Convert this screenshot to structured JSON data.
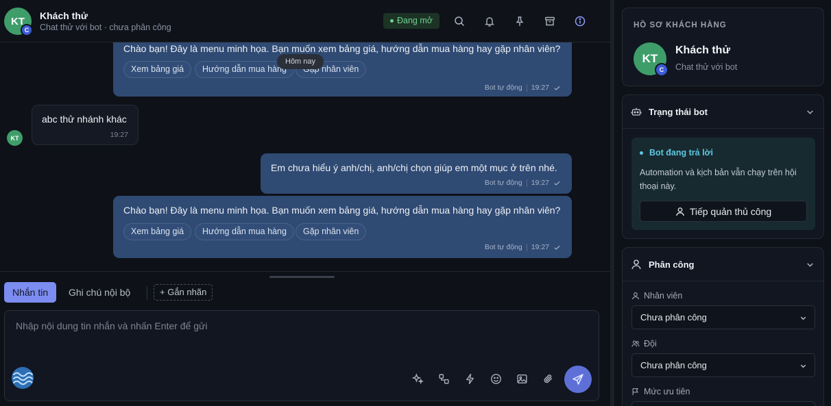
{
  "header": {
    "avatar_initials": "KT",
    "channel_badge": "C",
    "contact_name": "Khách thử",
    "subtitle": "Chat thử với bot · chưa phân công",
    "status": "Đang mở",
    "status_color": "#6fd190",
    "icons": [
      "search-icon",
      "bell-icon",
      "pin-icon",
      "archive-icon",
      "info-icon"
    ]
  },
  "messages": {
    "day_separator": "Hôm nay",
    "items": [
      {
        "direction": "outgoing",
        "text": "Chào bạn! Đây là menu minh họa. Bạn muốn xem bảng giá, hướng dẫn mua hàng hay gặp nhân viên?",
        "quick_replies": [
          "Xem bảng giá",
          "Hướng dẫn mua hàng",
          "Gặp nhân viên"
        ],
        "sender": "Bot tự động",
        "time": "19:27"
      },
      {
        "direction": "incoming",
        "avatar": "KT",
        "text": "abc thử nhánh khác",
        "time": "19:27"
      },
      {
        "direction": "outgoing",
        "text": "Em chưa hiểu ý anh/chị, anh/chị chọn giúp em một mục ở trên nhé.",
        "sender": "Bot tự động",
        "time": "19:27"
      },
      {
        "direction": "outgoing",
        "text": "Chào bạn! Đây là menu minh họa. Bạn muốn xem bảng giá, hướng dẫn mua hàng hay gặp nhân viên?",
        "quick_replies": [
          "Xem bảng giá",
          "Hướng dẫn mua hàng",
          "Gặp nhân viên"
        ],
        "sender": "Bot tự động",
        "time": "19:27"
      }
    ]
  },
  "composer": {
    "tabs": [
      "Nhắn tin",
      "Ghi chú nội bộ"
    ],
    "active_tab": "Nhắn tin",
    "label_button": "Gắn nhãn",
    "placeholder": "Nhập nội dung tin nhắn và nhấn Enter để gửi",
    "tools": [
      "sparkles-icon",
      "blocks-icon",
      "lightning-icon",
      "emoji-icon",
      "image-icon",
      "paperclip-icon"
    ],
    "send_icon": "send-icon",
    "accent_color": "#7c8cf0"
  },
  "profile": {
    "section_title": "HỒ SƠ KHÁCH HÀNG",
    "avatar_initials": "KT",
    "channel_badge": "C",
    "name": "Khách thử",
    "subtitle": "Chat thử với bot"
  },
  "bot_status": {
    "title": "Trạng thái bot",
    "state_title": "Bot đang trả lời",
    "state_color": "#5fc8e0",
    "description": "Automation và kịch bản vẫn chạy trên hội thoại này.",
    "button_label": "Tiếp quản thủ công"
  },
  "assignment": {
    "title": "Phân công",
    "agent_label": "Nhân viên",
    "agent_value": "Chưa phân công",
    "team_label": "Đội",
    "team_value": "Chưa phân công",
    "priority_label": "Mức ưu tiên"
  }
}
